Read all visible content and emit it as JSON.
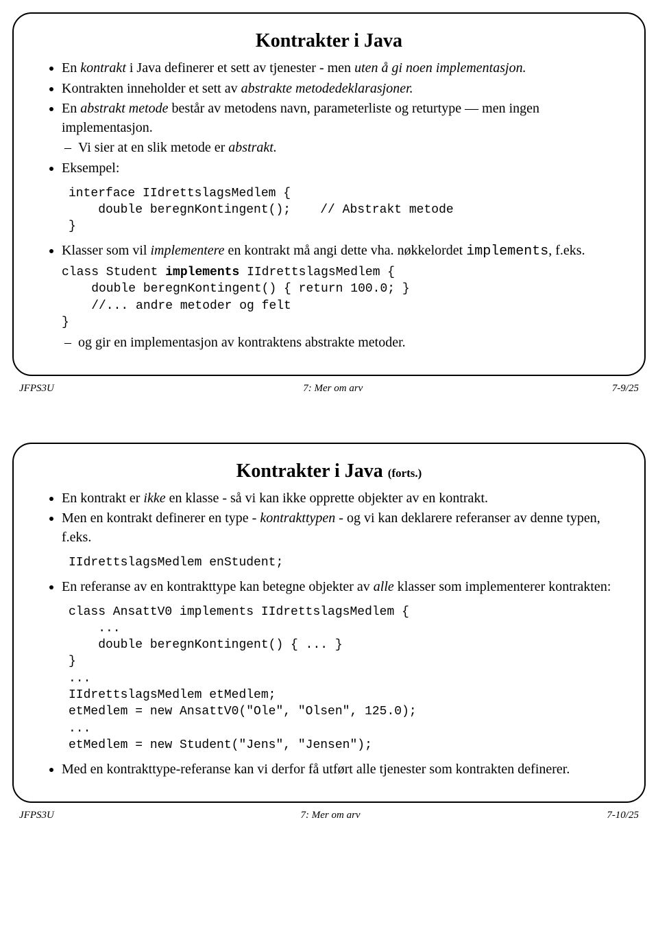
{
  "slide1": {
    "title": "Kontrakter i Java",
    "bullet1_a": "En ",
    "bullet1_b": "kontrakt",
    "bullet1_c": " i Java definerer et sett av tjenester - men ",
    "bullet1_d": "uten å gi noen implementasjon.",
    "bullet2_a": "Kontrakten inneholder et sett av ",
    "bullet2_b": "abstrakte metodedeklarasjoner.",
    "bullet3_a": "En ",
    "bullet3_b": "abstrakt metode",
    "bullet3_c": " består av metodens navn, parameterliste og returtype — men ingen implementasjon.",
    "bullet3_sub_a": "Vi sier at en slik metode er ",
    "bullet3_sub_b": "abstrakt.",
    "bullet4": "Eksempel:",
    "code1": "interface IIdrettslagsMedlem {\n    double beregnKontingent();    // Abstrakt metode\n}",
    "bullet5_a": "Klasser som vil ",
    "bullet5_b": "implementere",
    "bullet5_c": " en kontrakt må angi dette vha. nøkkelordet ",
    "bullet5_d": "implements",
    "bullet5_e": ", f.eks.",
    "code2_a": "class Student ",
    "code2_b": "implements",
    "code2_c": " IIdrettslagsMedlem {\n    double beregnKontingent() { return 100.0; }\n    //... andre metoder og felt\n}",
    "bullet5_sub": "og gir en implementasjon av kontraktens abstrakte metoder.",
    "footer_left": "JFPS3U",
    "footer_center": "7: Mer om arv",
    "footer_right": "7-9/25"
  },
  "slide2": {
    "title_a": "Kontrakter i Java ",
    "title_b": "(forts.)",
    "bullet1_a": "En kontrakt er ",
    "bullet1_b": "ikke",
    "bullet1_c": " en klasse - så vi kan ikke opprette objekter av en kontrakt.",
    "bullet2_a": "Men en kontrakt definerer en type - ",
    "bullet2_b": "kontrakttypen",
    "bullet2_c": " - og vi kan deklarere referanser av denne typen, f.eks.",
    "code1": "IIdrettslagsMedlem enStudent;",
    "bullet3_a": "En referanse av en kontrakttype kan betegne objekter av ",
    "bullet3_b": "alle",
    "bullet3_c": " klasser som implementerer kontrakten:",
    "code2": "class AnsattV0 implements IIdrettslagsMedlem {\n    ...\n    double beregnKontingent() { ... }\n}\n...\nIIdrettslagsMedlem etMedlem;\netMedlem = new AnsattV0(\"Ole\", \"Olsen\", 125.0);\n...\netMedlem = new Student(\"Jens\", \"Jensen\");",
    "bullet4": "Med en kontrakttype-referanse kan vi derfor få utført alle tjenester som kontrakten definerer.",
    "footer_left": "JFPS3U",
    "footer_center": "7: Mer om arv",
    "footer_right": "7-10/25"
  }
}
